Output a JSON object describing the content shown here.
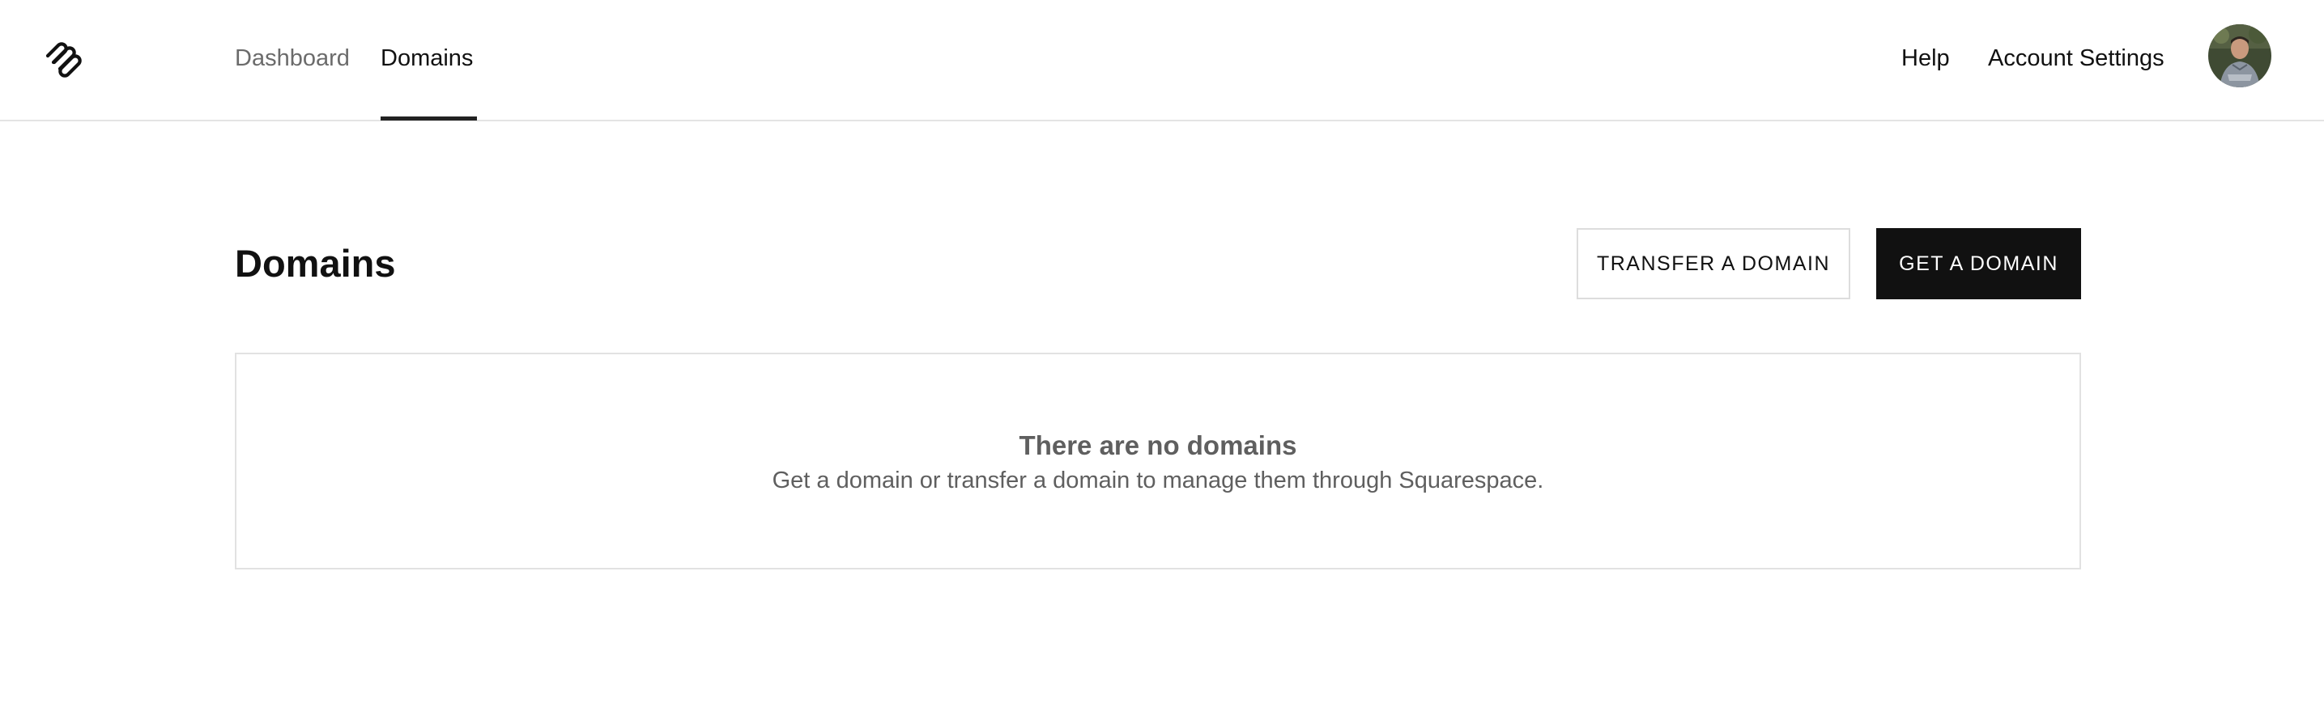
{
  "nav": {
    "logo_icon": "squarespace-logo-icon",
    "tabs": [
      {
        "label": "Dashboard",
        "active": false
      },
      {
        "label": "Domains",
        "active": true
      }
    ],
    "help_label": "Help",
    "account_settings_label": "Account Settings",
    "avatar_icon": "user-avatar"
  },
  "page": {
    "title": "Domains",
    "transfer_button_label": "TRANSFER A DOMAIN",
    "get_button_label": "GET A DOMAIN"
  },
  "empty_state": {
    "title": "There are no domains",
    "subtitle": "Get a domain or transfer a domain to manage them through Squarespace."
  },
  "colors": {
    "primary_button_bg": "#111111",
    "primary_button_text": "#ffffff",
    "muted_text": "#5f5f5f",
    "border": "#e2e2e2"
  }
}
